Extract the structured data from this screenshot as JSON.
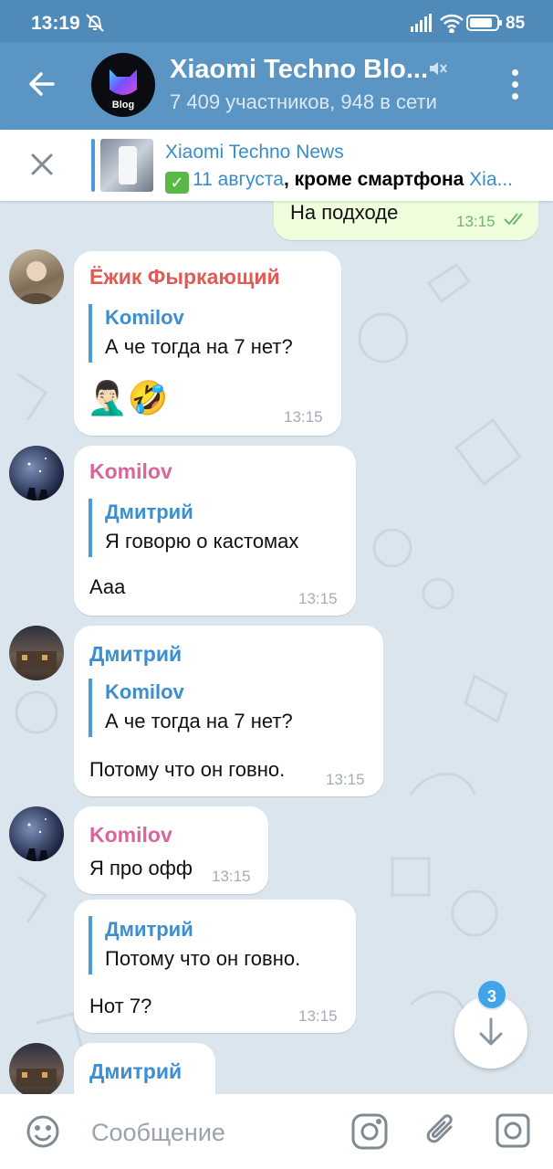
{
  "status_bar": {
    "time": "13:19",
    "battery": "85"
  },
  "header": {
    "title": "Xiaomi Techno Blo...",
    "subtitle": "7 409 участников, 948 в сети",
    "avatar_text": "Blog"
  },
  "pinned": {
    "title": "Xiaomi Techno News",
    "date": "11 августа",
    "text_bold": ", кроме смартфона",
    "text_tail": " Xia..."
  },
  "messages": [
    {
      "type": "outgoing",
      "text": "На подходе",
      "time": "13:15"
    },
    {
      "sender": "Ёжик Фыркающий",
      "sender_color": "#e35a55",
      "reply_name": "Komilov",
      "reply_text": "А че тогда на 7 нет?",
      "text": "",
      "emoji": "🤦🏻‍♂️🤣",
      "time": "13:15"
    },
    {
      "sender": "Komilov",
      "sender_color": "#d9659a",
      "reply_name": "Дмитрий",
      "reply_text": "Я говорю о кастомах",
      "text": "Ааа",
      "time": "13:15"
    },
    {
      "sender": "Дмитрий",
      "sender_color": "#3b8fd0",
      "reply_name": "Komilov",
      "reply_text": "А че тогда на 7 нет?",
      "text": "Потому что он говно.",
      "time": "13:15"
    },
    {
      "sender": "Komilov",
      "sender_color": "#d9659a",
      "text": "Я про офф",
      "time": "13:15"
    },
    {
      "reply_name": "Дмитрий",
      "reply_text": "Потому что он говно.",
      "text": "Нот 7?",
      "time": "13:15"
    },
    {
      "sender": "Дмитрий",
      "sender_color": "#3b8fd0"
    }
  ],
  "scroll_down": {
    "badge": "3"
  },
  "input": {
    "placeholder": "Сообщение"
  }
}
